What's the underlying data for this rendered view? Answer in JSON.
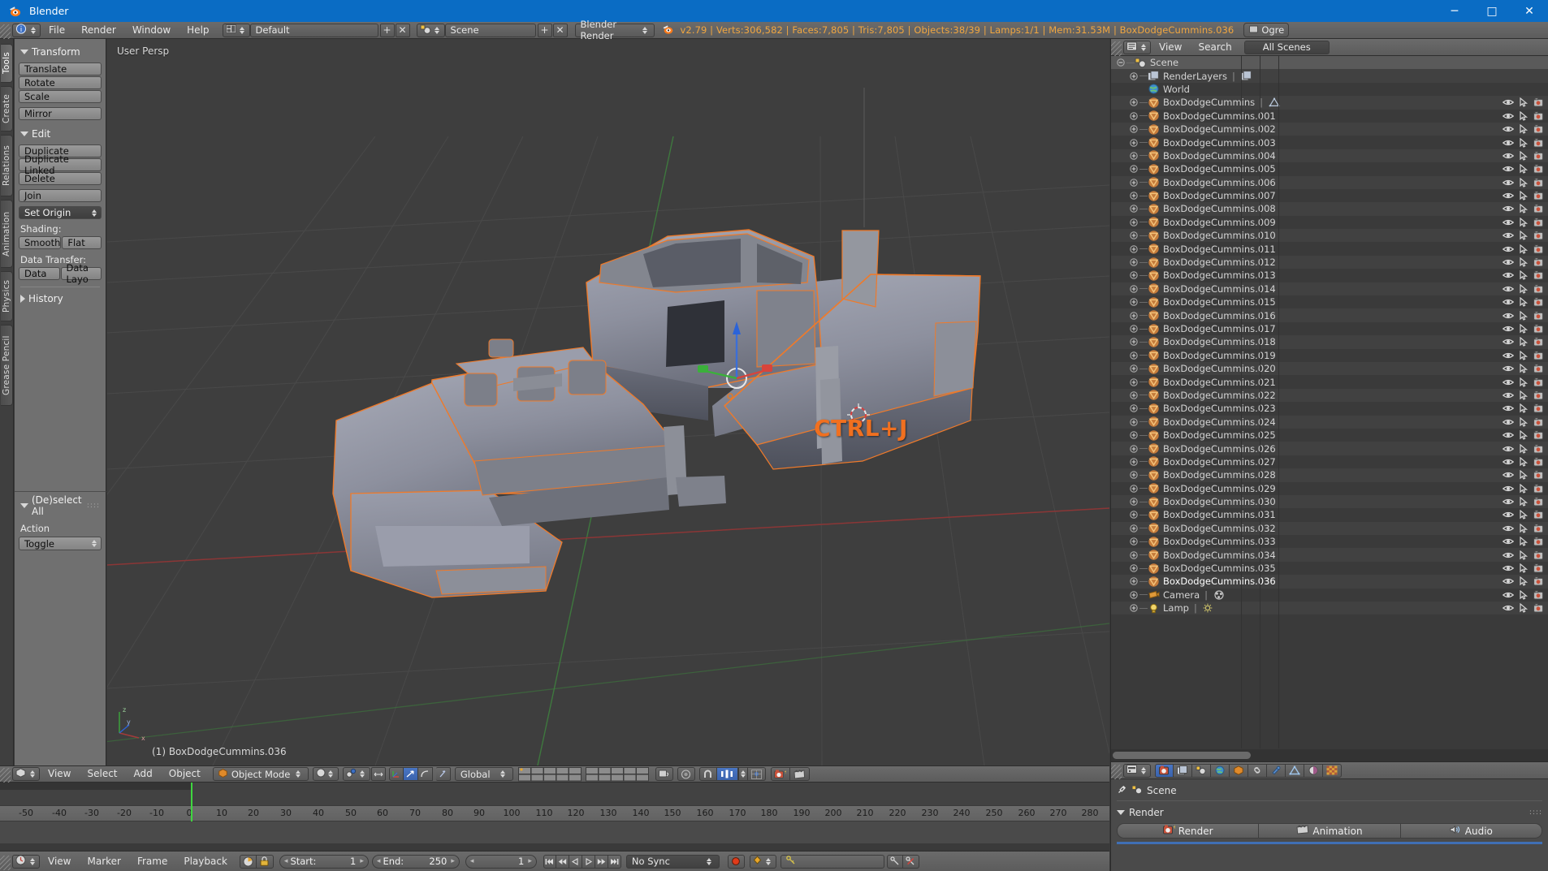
{
  "window": {
    "title": "Blender",
    "icon": "blender-logo-icon",
    "minimize": "─",
    "maximize": "□",
    "close": "✕"
  },
  "topbar": {
    "editor_type_icon": "info-editor-icon",
    "menus": [
      "File",
      "Render",
      "Window",
      "Help"
    ],
    "screen_layout": {
      "icon": "screen-layout-icon",
      "value": "Default",
      "add": "+",
      "remove": "✕"
    },
    "scene": {
      "icon": "scene-icon",
      "value": "Scene",
      "add": "+",
      "remove": "✕"
    },
    "engine": {
      "value": "Blender Render"
    },
    "blender_icon": "blender-small-icon",
    "stats": "v2.79 | Verts:306,582 | Faces:7,805 | Tris:7,805 | Objects:38/39 | Lamps:1/1 | Mem:31.53M | BoxDodgeCummins.036",
    "stats_color": "#f0a640",
    "ogre_button": {
      "label": "Ogre",
      "icon": "ogre-icon"
    }
  },
  "tool_tabs": [
    {
      "label": "Tools",
      "active": true
    },
    {
      "label": "Create",
      "active": false
    },
    {
      "label": "Relations",
      "active": false
    },
    {
      "label": "Animation",
      "active": false
    },
    {
      "label": "Physics",
      "active": false
    },
    {
      "label": "Grease Pencil",
      "active": false
    }
  ],
  "tool_panel": {
    "sections": [
      {
        "title": "Transform",
        "expanded": true,
        "buttons": [
          "Translate",
          "Rotate",
          "Scale"
        ],
        "buttons2": [
          "Mirror"
        ]
      },
      {
        "title": "Edit",
        "expanded": true,
        "buttons": [
          "Duplicate",
          "Duplicate Linked",
          "Delete"
        ],
        "buttons2": [
          "Join"
        ],
        "highlighted": "Set Origin",
        "shading_label": "Shading:",
        "shading_buttons": [
          "Smooth",
          "Flat"
        ],
        "transfer_label": "Data Transfer:",
        "transfer_buttons": [
          "Data",
          "Data Layo"
        ]
      }
    ],
    "history": {
      "title": "History",
      "expanded": false
    }
  },
  "operator_panel": {
    "title": "(De)select All",
    "expanded": true,
    "action_label": "Action",
    "action_value": "Toggle"
  },
  "viewport": {
    "view_label": "User Persp",
    "active_object_label": "(1) BoxDodgeCummins.036",
    "overlay_text": "CTRL+J",
    "overlay_color": "#f07020",
    "background": "#3e3e3e",
    "grid_color": "#4a4a4a",
    "axis_x_color": "#a33b3b",
    "axis_y_color": "#3b9b3b",
    "selection_color": "#ef7a2a",
    "model_color": "#8b8e9b",
    "gizmo": {
      "x": "X",
      "y": "Y",
      "z": "Z"
    }
  },
  "viewport_header": {
    "editor_icon": "3dview-editor-icon",
    "menus": [
      "View",
      "Select",
      "Add",
      "Object"
    ],
    "mode": {
      "icon": "object-mode-icon",
      "value": "Object Mode"
    },
    "viewport_shading": "solid-shade-icon",
    "pivot": "pivot-icon",
    "manipulator_toggles": [
      "translate-manipulator-icon",
      "rotate-manipulator-icon",
      "scale-manipulator-icon"
    ],
    "transform_orientation": "Global",
    "layers_icon": "scene-layers-grid",
    "other_icons": [
      "lock-object-icon",
      "proportional-edit-icon",
      "snap-magnet-icon",
      "snap-element-icon",
      "snap-target-icon",
      "render-opengl-icon",
      "render-opengl-anim-icon"
    ]
  },
  "timeline": {
    "editor_icon": "timeline-editor-icon",
    "menus": [
      "View",
      "Marker",
      "Frame",
      "Playback"
    ],
    "toggles": [
      "playhead-only-icon",
      "lock-time-icon"
    ],
    "start": {
      "label": "Start:",
      "value": "1"
    },
    "end": {
      "label": "End:",
      "value": "250"
    },
    "current_frame": "1",
    "transport": [
      "jump-start-icon",
      "prev-keyframe-icon",
      "play-reverse-icon",
      "play-icon",
      "next-keyframe-icon",
      "jump-end-icon"
    ],
    "sync_mode": "No Sync",
    "record_icon": "record-icon",
    "keyingset_icon": "keyingset-icon",
    "keyingset_value": "",
    "insert_key_icon": "insert-keyframe-icon",
    "delete_key_icon": "delete-keyframe-icon",
    "ruler_ticks": [
      -50,
      -40,
      -30,
      -20,
      -10,
      0,
      10,
      20,
      30,
      40,
      50,
      60,
      70,
      80,
      90,
      100,
      110,
      120,
      130,
      140,
      150,
      160,
      170,
      180,
      190,
      200,
      210,
      220,
      230,
      240,
      250,
      260,
      270,
      280
    ],
    "playhead_frame": 1
  },
  "outliner": {
    "header": {
      "display_mode_icon": "outliner-display-mode-icon",
      "menus": [
        "View",
        "Search"
      ],
      "scene_filter": "All Scenes"
    },
    "rows": [
      {
        "label": "Scene",
        "icon": "scene-icon",
        "depth": 0,
        "expand": "down",
        "selected": true,
        "restrict": false
      },
      {
        "label": "RenderLayers",
        "icon": "renderlayer-icon",
        "depth": 1,
        "expand": "plus",
        "extra": "renderlayer-data-icon",
        "restrict": false
      },
      {
        "label": "World",
        "icon": "world-icon",
        "depth": 1,
        "expand": "none",
        "restrict": false
      },
      {
        "label": "BoxDodgeCummins",
        "icon": "mesh-icon",
        "depth": 1,
        "expand": "plus",
        "extra": "mesh-data-icon",
        "restrict": true
      },
      {
        "label": "BoxDodgeCummins.001",
        "icon": "mesh-icon",
        "depth": 1,
        "expand": "plus",
        "restrict": true
      },
      {
        "label": "BoxDodgeCummins.002",
        "icon": "mesh-icon",
        "depth": 1,
        "expand": "plus",
        "restrict": true
      },
      {
        "label": "BoxDodgeCummins.003",
        "icon": "mesh-icon",
        "depth": 1,
        "expand": "plus",
        "restrict": true
      },
      {
        "label": "BoxDodgeCummins.004",
        "icon": "mesh-icon",
        "depth": 1,
        "expand": "plus",
        "restrict": true
      },
      {
        "label": "BoxDodgeCummins.005",
        "icon": "mesh-icon",
        "depth": 1,
        "expand": "plus",
        "restrict": true
      },
      {
        "label": "BoxDodgeCummins.006",
        "icon": "mesh-icon",
        "depth": 1,
        "expand": "plus",
        "restrict": true
      },
      {
        "label": "BoxDodgeCummins.007",
        "icon": "mesh-icon",
        "depth": 1,
        "expand": "plus",
        "restrict": true
      },
      {
        "label": "BoxDodgeCummins.008",
        "icon": "mesh-icon",
        "depth": 1,
        "expand": "plus",
        "restrict": true
      },
      {
        "label": "BoxDodgeCummins.009",
        "icon": "mesh-icon",
        "depth": 1,
        "expand": "plus",
        "restrict": true
      },
      {
        "label": "BoxDodgeCummins.010",
        "icon": "mesh-icon",
        "depth": 1,
        "expand": "plus",
        "restrict": true
      },
      {
        "label": "BoxDodgeCummins.011",
        "icon": "mesh-icon",
        "depth": 1,
        "expand": "plus",
        "restrict": true
      },
      {
        "label": "BoxDodgeCummins.012",
        "icon": "mesh-icon",
        "depth": 1,
        "expand": "plus",
        "restrict": true
      },
      {
        "label": "BoxDodgeCummins.013",
        "icon": "mesh-icon",
        "depth": 1,
        "expand": "plus",
        "restrict": true
      },
      {
        "label": "BoxDodgeCummins.014",
        "icon": "mesh-icon",
        "depth": 1,
        "expand": "plus",
        "restrict": true
      },
      {
        "label": "BoxDodgeCummins.015",
        "icon": "mesh-icon",
        "depth": 1,
        "expand": "plus",
        "restrict": true
      },
      {
        "label": "BoxDodgeCummins.016",
        "icon": "mesh-icon",
        "depth": 1,
        "expand": "plus",
        "restrict": true
      },
      {
        "label": "BoxDodgeCummins.017",
        "icon": "mesh-icon",
        "depth": 1,
        "expand": "plus",
        "restrict": true
      },
      {
        "label": "BoxDodgeCummins.018",
        "icon": "mesh-icon",
        "depth": 1,
        "expand": "plus",
        "restrict": true
      },
      {
        "label": "BoxDodgeCummins.019",
        "icon": "mesh-icon",
        "depth": 1,
        "expand": "plus",
        "restrict": true
      },
      {
        "label": "BoxDodgeCummins.020",
        "icon": "mesh-icon",
        "depth": 1,
        "expand": "plus",
        "restrict": true
      },
      {
        "label": "BoxDodgeCummins.021",
        "icon": "mesh-icon",
        "depth": 1,
        "expand": "plus",
        "restrict": true
      },
      {
        "label": "BoxDodgeCummins.022",
        "icon": "mesh-icon",
        "depth": 1,
        "expand": "plus",
        "restrict": true
      },
      {
        "label": "BoxDodgeCummins.023",
        "icon": "mesh-icon",
        "depth": 1,
        "expand": "plus",
        "restrict": true
      },
      {
        "label": "BoxDodgeCummins.024",
        "icon": "mesh-icon",
        "depth": 1,
        "expand": "plus",
        "restrict": true
      },
      {
        "label": "BoxDodgeCummins.025",
        "icon": "mesh-icon",
        "depth": 1,
        "expand": "plus",
        "restrict": true
      },
      {
        "label": "BoxDodgeCummins.026",
        "icon": "mesh-icon",
        "depth": 1,
        "expand": "plus",
        "restrict": true
      },
      {
        "label": "BoxDodgeCummins.027",
        "icon": "mesh-icon",
        "depth": 1,
        "expand": "plus",
        "restrict": true
      },
      {
        "label": "BoxDodgeCummins.028",
        "icon": "mesh-icon",
        "depth": 1,
        "expand": "plus",
        "restrict": true
      },
      {
        "label": "BoxDodgeCummins.029",
        "icon": "mesh-icon",
        "depth": 1,
        "expand": "plus",
        "restrict": true
      },
      {
        "label": "BoxDodgeCummins.030",
        "icon": "mesh-icon",
        "depth": 1,
        "expand": "plus",
        "restrict": true
      },
      {
        "label": "BoxDodgeCummins.031",
        "icon": "mesh-icon",
        "depth": 1,
        "expand": "plus",
        "restrict": true
      },
      {
        "label": "BoxDodgeCummins.032",
        "icon": "mesh-icon",
        "depth": 1,
        "expand": "plus",
        "restrict": true
      },
      {
        "label": "BoxDodgeCummins.033",
        "icon": "mesh-icon",
        "depth": 1,
        "expand": "plus",
        "restrict": true
      },
      {
        "label": "BoxDodgeCummins.034",
        "icon": "mesh-icon",
        "depth": 1,
        "expand": "plus",
        "restrict": true
      },
      {
        "label": "BoxDodgeCummins.035",
        "icon": "mesh-icon",
        "depth": 1,
        "expand": "plus",
        "restrict": true
      },
      {
        "label": "BoxDodgeCummins.036",
        "icon": "mesh-icon",
        "depth": 1,
        "expand": "plus",
        "active": true,
        "restrict": true
      },
      {
        "label": "Camera",
        "icon": "camera-icon",
        "depth": 1,
        "expand": "plus",
        "extra": "camera-data-icon",
        "restrict": true
      },
      {
        "label": "Lamp",
        "icon": "lamp-icon",
        "depth": 1,
        "expand": "plus",
        "extra": "lamp-data-icon",
        "restrict": true
      }
    ]
  },
  "properties": {
    "header_tabs": [
      "render-tab-icon",
      "renderlayers-tab-icon",
      "scene-tab-icon",
      "world-tab-icon",
      "object-tab-icon",
      "constraints-tab-icon",
      "modifiers-tab-icon",
      "data-tab-icon",
      "material-tab-icon",
      "texture-tab-icon"
    ],
    "active_tab_index": 0,
    "breadcrumb_icon": "pin-icon",
    "breadcrumb_scene_icon": "scene-icon",
    "breadcrumb": "Scene",
    "panel_title": "Render",
    "panel_expanded": true,
    "buttons": [
      {
        "label": "Render",
        "icon": "render-image-icon"
      },
      {
        "label": "Animation",
        "icon": "render-anim-icon"
      },
      {
        "label": "Audio",
        "icon": "render-audio-icon"
      }
    ]
  }
}
